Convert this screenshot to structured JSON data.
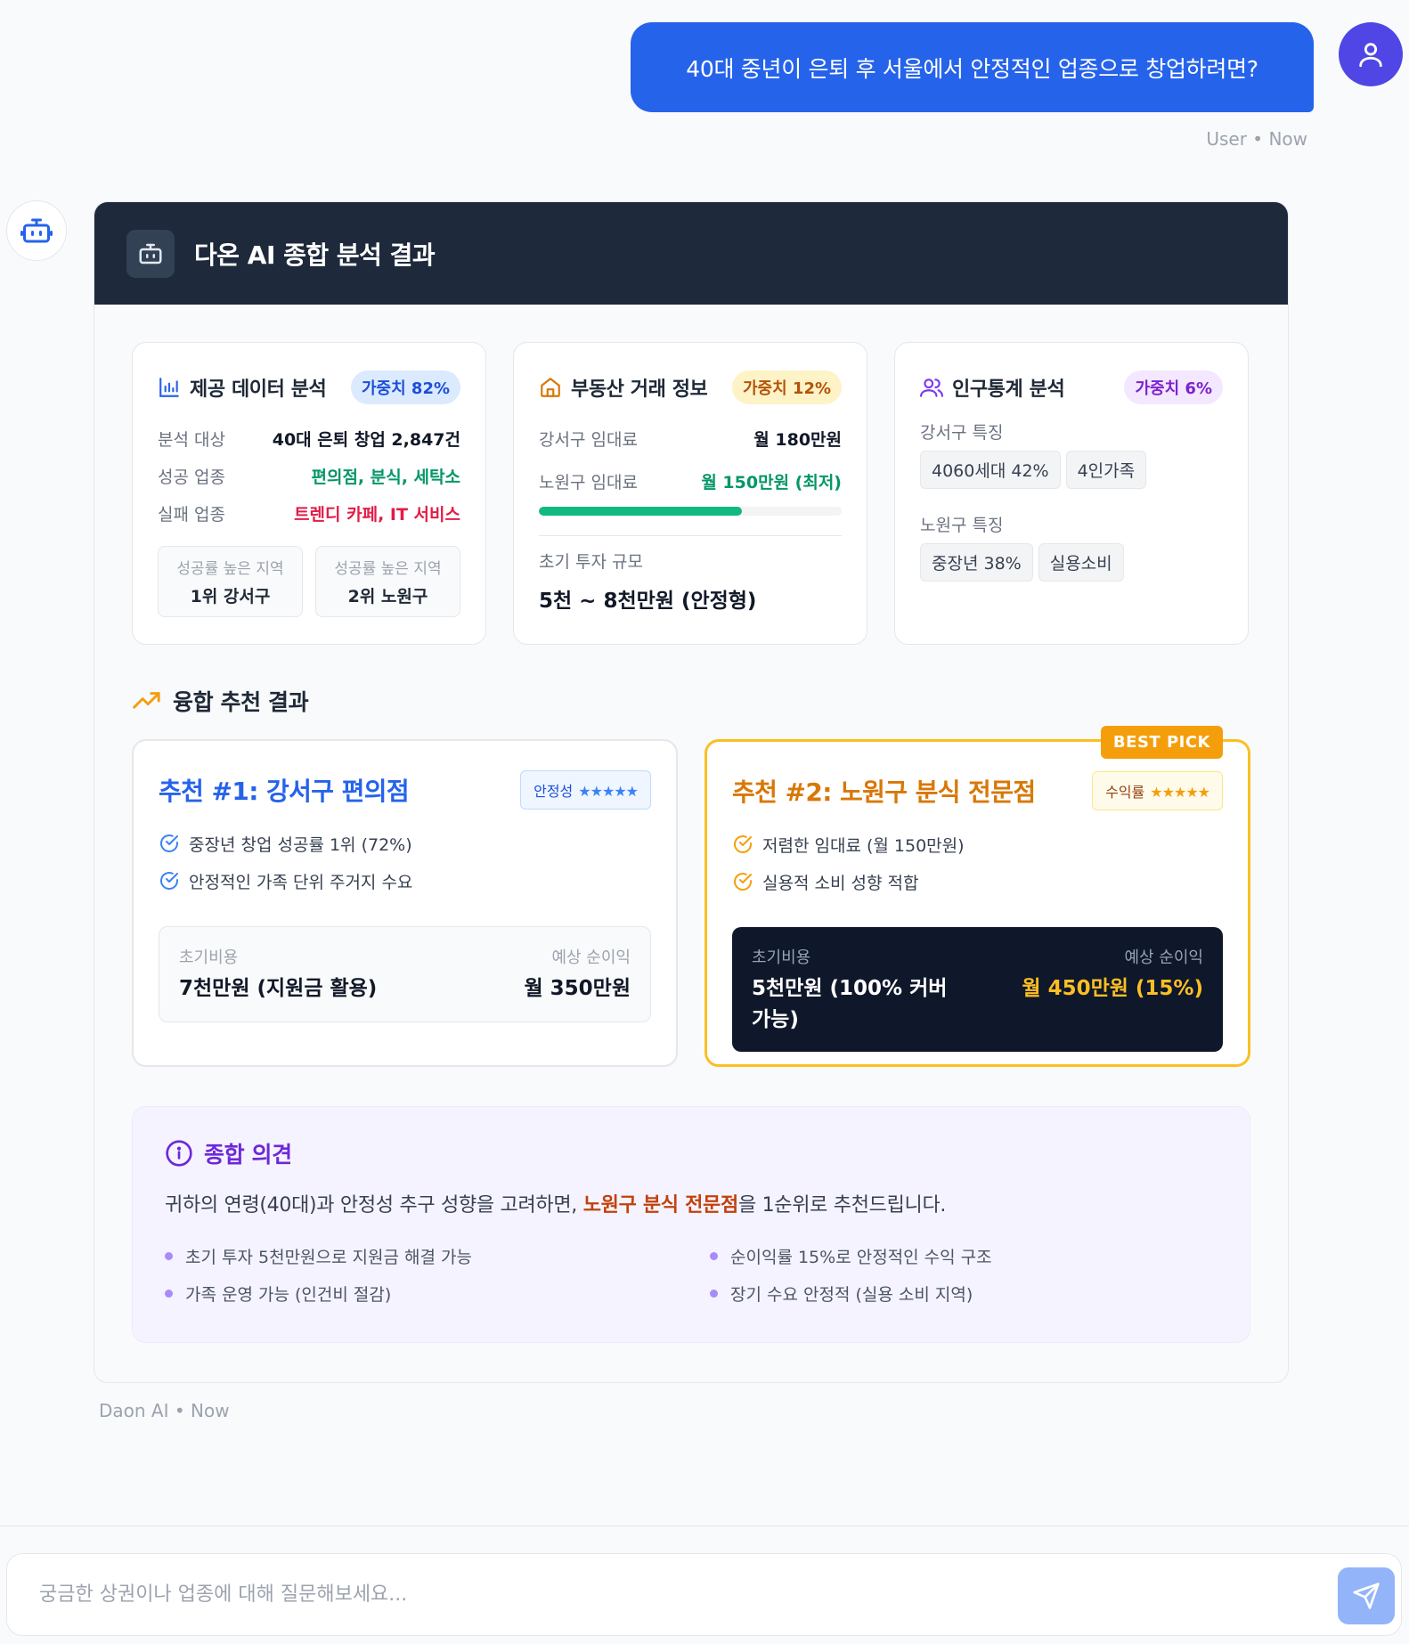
{
  "user_message": {
    "text": "40대 중년이 은퇴 후 서울에서 안정적인 업종으로 창업하려면?",
    "meta": "User • Now"
  },
  "ai_card": {
    "title": "다온 AI 종합 분석 결과",
    "data_card": {
      "title": "제공 데이터 분석",
      "weight": "가중치 82%",
      "rows": [
        {
          "label": "분석 대상",
          "value": "40대 은퇴 창업 2,847건"
        },
        {
          "label": "성공 업종",
          "value": "편의점, 분식, 세탁소"
        },
        {
          "label": "실패 업종",
          "value": "트렌디 카페, IT 서비스"
        }
      ],
      "regions": [
        {
          "label": "성공률 높은 지역",
          "value": "1위 강서구"
        },
        {
          "label": "성공률 높은 지역",
          "value": "2위 노원구"
        }
      ]
    },
    "realestate_card": {
      "title": "부동산 거래 정보",
      "weight": "가중치 12%",
      "rows": [
        {
          "label": "강서구 임대료",
          "value": "월 180만원"
        },
        {
          "label": "노원구 임대료",
          "value": "월 150만원 (최저)"
        }
      ],
      "rent_bar_fraction": 0.67,
      "invest_label": "초기 투자 규모",
      "invest_value": "5천 ~ 8천만원 (안정형)"
    },
    "demo_card": {
      "title": "인구통계 분석",
      "weight": "가중치 6%",
      "groups": [
        {
          "label": "강서구 특징",
          "tags": [
            "4060세대 42%",
            "4인가족"
          ]
        },
        {
          "label": "노원구 특징",
          "tags": [
            "중장년 38%",
            "실용소비"
          ]
        }
      ]
    },
    "section_title": "융합 추천 결과",
    "rec1": {
      "title": "추천 #1: 강서구 편의점",
      "rating_label": "안정성",
      "stars": "★★★★★",
      "checks": [
        "중장년 창업 성공률 1위 (72%)",
        "안정적인 가족 단위 주거지 수요"
      ],
      "cost_label": "초기비용",
      "cost_value": "7천만원 (지원금 활용)",
      "profit_label": "예상 순이익",
      "profit_value": "월 350만원"
    },
    "rec2": {
      "badge": "BEST PICK",
      "title": "추천 #2: 노원구 분식 전문점",
      "rating_label": "수익률",
      "stars": "★★★★★",
      "checks": [
        "저렴한 임대료 (월 150만원)",
        "실용적 소비 성향 적합"
      ],
      "cost_label": "초기비용",
      "cost_value_line1": "5천만원 (100% 커버",
      "cost_value_line2": "가능)",
      "profit_label": "예상 순이익",
      "profit_value": "월 450만원 (15%)"
    },
    "opinion": {
      "title": "종합 의견",
      "text_before": "귀하의 연령(40대)과 안정성 추구 성향을 고려하면, ",
      "text_highlight": "노원구 분식 전문점",
      "text_after": "을 1순위로 추천드립니다.",
      "bullets": [
        "초기 투자 5천만원으로 지원금 해결 가능",
        "순이익률 15%로 안정적인 수익 구조",
        "가족 운영 가능 (인건비 절감)",
        "장기 수요 안정적 (실용 소비 지역)"
      ]
    }
  },
  "ai_meta": "Daon AI • Now",
  "input": {
    "placeholder": "궁금한 상권이나 업종에 대해 질문해보세요..."
  },
  "colors": {
    "primary": "#2563eb",
    "header_dark": "#1e293b",
    "success": "#059669",
    "danger": "#e11d48",
    "accent_orange": "#d97706",
    "accent_purple": "#7c3aed",
    "best_border": "#fbbf24"
  }
}
